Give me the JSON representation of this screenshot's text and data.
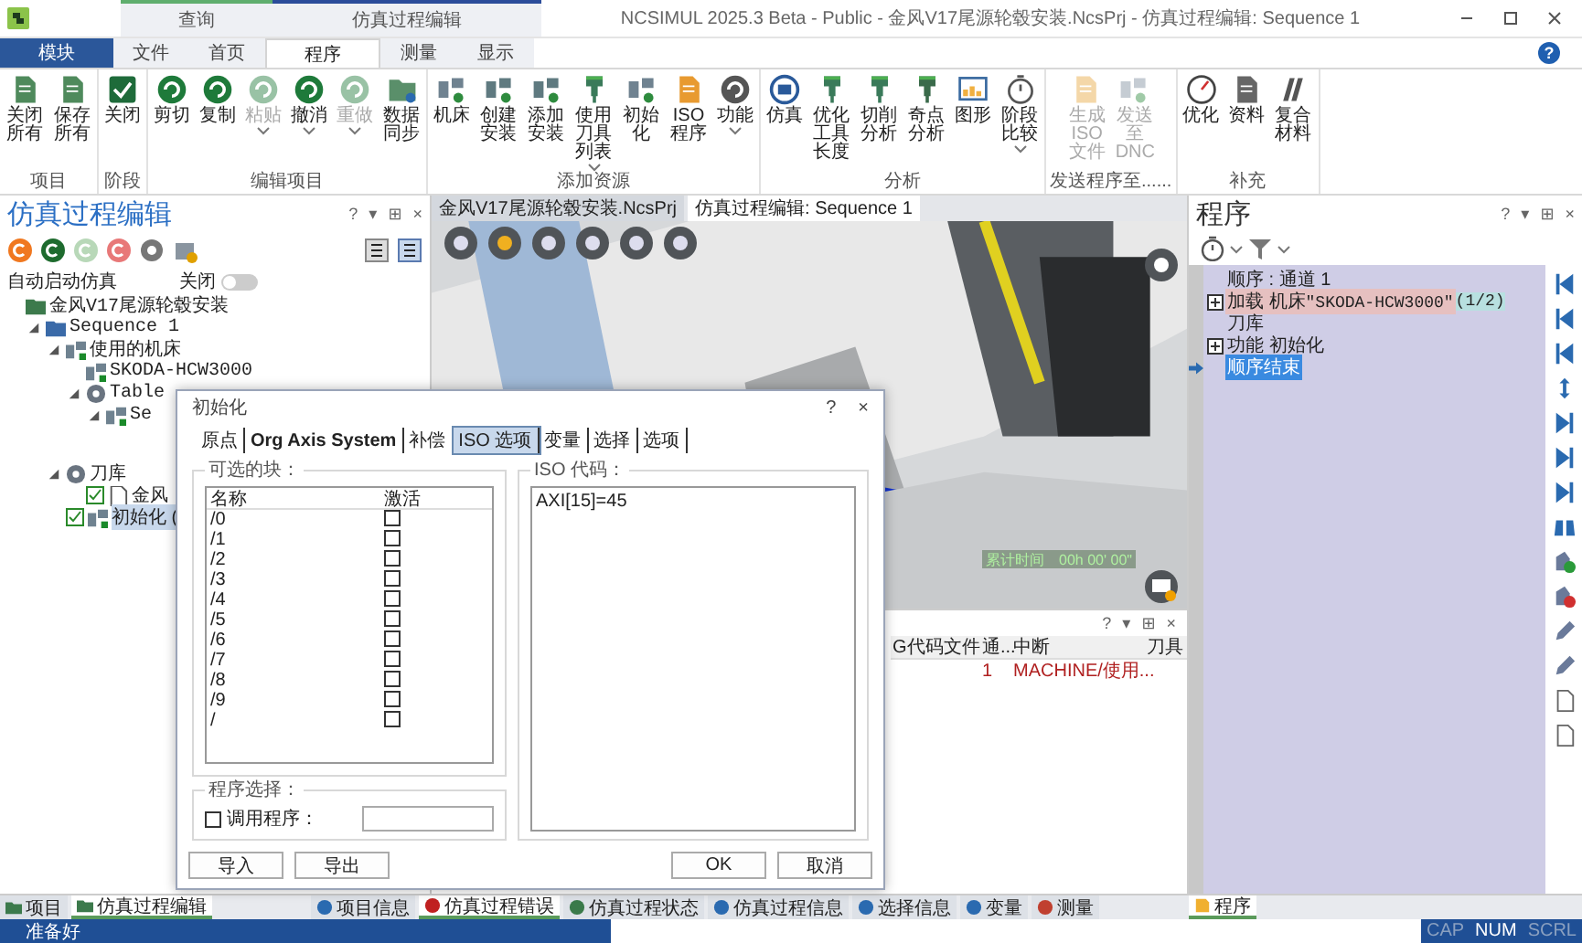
{
  "window": {
    "title": "NCSIMUL 2025.3 Beta - Public - 金风V17尾源轮毂安装.NcsPrj - 仿真过程编辑: Sequence 1",
    "help": "?"
  },
  "context_groups": [
    {
      "label": "查询",
      "color": "#5fae6e"
    },
    {
      "label": "仿真过程编辑",
      "color": "#2b4c9a"
    }
  ],
  "module_button": "模块",
  "tabs": [
    {
      "label": "文件",
      "selected": false
    },
    {
      "label": "首页",
      "selected": false
    },
    {
      "label": "程序",
      "selected": true
    },
    {
      "label": "测量",
      "selected": false
    },
    {
      "label": "显示",
      "selected": false
    }
  ],
  "ribbon": {
    "groups": [
      {
        "label": "项目",
        "buttons": [
          {
            "label": "关闭所有",
            "disabled": false,
            "dropdown": false
          },
          {
            "label": "保存所有",
            "disabled": false,
            "dropdown": false
          }
        ]
      },
      {
        "label": "阶段",
        "buttons": [
          {
            "label": "关闭",
            "disabled": false,
            "dropdown": false
          }
        ]
      },
      {
        "label": "编辑项目",
        "buttons": [
          {
            "label": "剪切",
            "disabled": false,
            "dropdown": false
          },
          {
            "label": "复制",
            "disabled": false,
            "dropdown": false
          },
          {
            "label": "粘贴",
            "disabled": true,
            "dropdown": true
          },
          {
            "label": "撤消",
            "disabled": false,
            "dropdown": true
          },
          {
            "label": "重做",
            "disabled": true,
            "dropdown": true
          },
          {
            "label": "数据同步",
            "disabled": false,
            "dropdown": false
          }
        ]
      },
      {
        "label": "添加资源",
        "buttons": [
          {
            "label": "机床",
            "disabled": false,
            "dropdown": false
          },
          {
            "label": "创建安装",
            "disabled": false,
            "dropdown": false
          },
          {
            "label": "添加安装",
            "disabled": false,
            "dropdown": false
          },
          {
            "label": "使用刀具列表",
            "disabled": false,
            "dropdown": true
          },
          {
            "label": "初始化",
            "disabled": false,
            "dropdown": false
          },
          {
            "label": "ISO程序",
            "disabled": false,
            "dropdown": false
          },
          {
            "label": "功能",
            "disabled": false,
            "dropdown": true
          }
        ]
      },
      {
        "label": "分析",
        "buttons": [
          {
            "label": "仿真",
            "disabled": false,
            "dropdown": false
          },
          {
            "label": "优化工具长度",
            "disabled": false,
            "dropdown": false
          },
          {
            "label": "切削分析",
            "disabled": false,
            "dropdown": false
          },
          {
            "label": "奇点分析",
            "disabled": false,
            "dropdown": false
          },
          {
            "label": "图形",
            "disabled": false,
            "dropdown": false
          },
          {
            "label": "阶段比较",
            "disabled": false,
            "dropdown": true
          }
        ]
      },
      {
        "label": "发送程序至......",
        "buttons": [
          {
            "label": "生成ISO文件",
            "disabled": true,
            "dropdown": false
          },
          {
            "label": "发送至DNC",
            "disabled": true,
            "dropdown": false
          }
        ]
      },
      {
        "label": "补充",
        "buttons": [
          {
            "label": "优化",
            "disabled": false,
            "dropdown": false
          },
          {
            "label": "资料",
            "disabled": false,
            "dropdown": false
          },
          {
            "label": "复合材料",
            "disabled": false,
            "dropdown": false
          }
        ]
      }
    ]
  },
  "left_panel": {
    "title": "仿真过程编辑",
    "controls": [
      "?",
      "▾",
      "⊞",
      "×"
    ],
    "auto_start": {
      "label": "自动启动仿真",
      "toggle_label": "关闭",
      "on": false
    },
    "tree": [
      {
        "label": "金风V17尾源轮毂安装",
        "kind": "project",
        "selected": false,
        "children": [
          {
            "label": "Sequence 1",
            "kind": "sequence",
            "expanded": true,
            "selected": false,
            "children": [
              {
                "label": "使用的机床",
                "kind": "machine",
                "expanded": true,
                "selected": false,
                "children": [
                  {
                    "label": "SKODA-HCW3000",
                    "kind": "machine-item",
                    "selected": false
                  },
                  {
                    "label": "Table",
                    "kind": "table",
                    "expanded": true,
                    "selected": false,
                    "children": [
                      {
                        "label": "Se",
                        "kind": "stock",
                        "expanded": true,
                        "selected": false
                      }
                    ]
                  }
                ]
              },
              {
                "label": "刀库",
                "kind": "tools",
                "expanded": true,
                "selected": false,
                "children": [
                  {
                    "label": "金风",
                    "kind": "file",
                    "checked": true,
                    "selected": false
                  }
                ]
              },
              {
                "label": "初始化 (",
                "kind": "init",
                "checked": true,
                "selected": true
              }
            ]
          }
        ]
      }
    ]
  },
  "doc_tabs": [
    {
      "label": "金风V17尾源轮毂安装.NcsPrj",
      "selected": false
    },
    {
      "label": "仿真过程编辑: Sequence 1",
      "selected": true
    }
  ],
  "view": {
    "timer_label": "累计时间",
    "timer_value": "00h 00' 00\""
  },
  "output_panel": {
    "controls": [
      "?",
      "▾",
      "⊞",
      "×"
    ],
    "columns": [
      "G代码文件",
      "通...",
      "中断",
      "刀具"
    ],
    "rows": [
      {
        "cells": [
          null,
          "1",
          "MACHINE/使用...",
          null
        ]
      }
    ]
  },
  "program_panel": {
    "title": "程序",
    "controls": [
      "?",
      "▾",
      "⊞",
      "×"
    ],
    "lines": [
      {
        "text": "顺序 : 通道 1",
        "expandable": false,
        "highlighted": false,
        "current": false,
        "selected": false
      },
      {
        "text": "加载 机床",
        "code": "\"SKODA-HCW3000\"",
        "badge": "(1/2)",
        "expandable": true,
        "highlighted": true,
        "current": false,
        "selected": false
      },
      {
        "text": "刀库",
        "expandable": false,
        "highlighted": false,
        "current": false,
        "selected": false
      },
      {
        "text": "功能 初始化",
        "expandable": true,
        "highlighted": false,
        "current": false,
        "selected": false
      },
      {
        "text": "顺序结束",
        "expandable": false,
        "highlighted": false,
        "current": true,
        "selected": true
      }
    ]
  },
  "dialog": {
    "title": "初始化",
    "controls": [
      "?",
      "×"
    ],
    "tabs": [
      {
        "label": "原点",
        "selected": false
      },
      {
        "label": "Org Axis System",
        "selected": false
      },
      {
        "label": "补偿",
        "selected": false
      },
      {
        "label": "ISO 选项",
        "selected": true
      },
      {
        "label": "变量",
        "selected": false
      },
      {
        "label": "选择",
        "selected": false
      },
      {
        "label": "选项",
        "selected": false
      }
    ],
    "blocks_label": "可选的块：",
    "columns": [
      "名称",
      "激活"
    ],
    "blocks": [
      {
        "name": "/0",
        "active": false
      },
      {
        "name": "/1",
        "active": false
      },
      {
        "name": "/2",
        "active": false
      },
      {
        "name": "/3",
        "active": false
      },
      {
        "name": "/4",
        "active": false
      },
      {
        "name": "/5",
        "active": false
      },
      {
        "name": "/6",
        "active": false
      },
      {
        "name": "/7",
        "active": false
      },
      {
        "name": "/8",
        "active": false
      },
      {
        "name": "/9",
        "active": false
      },
      {
        "name": "/",
        "active": false
      }
    ],
    "iso_label": "ISO 代码：",
    "iso_code": "AXI[15]=45",
    "program_selection": {
      "label": "程序选择：",
      "call_label": "调用程序：",
      "checked": false
    },
    "buttons_left": [
      "导入",
      "导出"
    ],
    "buttons_right": [
      "OK",
      "取消"
    ]
  },
  "bottom_tabs": {
    "left": [
      {
        "label": "项目",
        "selected": false
      },
      {
        "label": "仿真过程编辑",
        "selected": true
      }
    ],
    "center": [
      {
        "label": "项目信息",
        "selected": false
      },
      {
        "label": "仿真过程错误",
        "selected": true
      },
      {
        "label": "仿真过程状态",
        "selected": false
      },
      {
        "label": "仿真过程信息",
        "selected": false
      },
      {
        "label": "选择信息",
        "selected": false
      },
      {
        "label": "变量",
        "selected": false
      },
      {
        "label": "测量",
        "selected": false
      }
    ],
    "right": [
      {
        "label": "程序",
        "selected": true
      }
    ]
  },
  "status_bar": {
    "text": "准备好",
    "indicators": [
      {
        "label": "CAP",
        "on": false
      },
      {
        "label": "NUM",
        "on": true
      },
      {
        "label": "SCRL",
        "on": false
      }
    ]
  }
}
